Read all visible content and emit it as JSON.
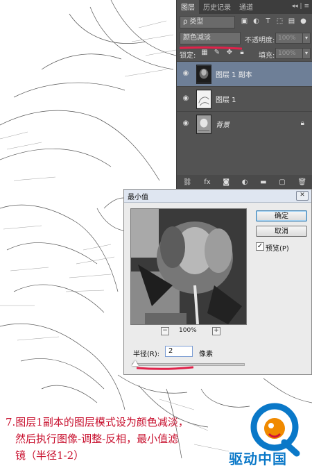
{
  "layers_panel": {
    "tabs": [
      "图层",
      "历史记录",
      "通道"
    ],
    "panel_menu": "◂◂ | ≡",
    "kind_filter": "ρ 类型",
    "blend_mode": "颜色减淡",
    "opacity_label": "不透明度:",
    "opacity_value": "100%",
    "lock_label": "锁定:",
    "fill_label": "填充:",
    "fill_value": "100%",
    "layers": [
      {
        "name": "图层 1 副本",
        "selected": true
      },
      {
        "name": "图层 1",
        "selected": false
      },
      {
        "name": "背景",
        "selected": false,
        "locked": true
      }
    ],
    "bottom_icons": [
      "link-icon",
      "fx-icon",
      "mask-icon",
      "adjustment-icon",
      "group-icon",
      "new-layer-icon",
      "trash-icon"
    ]
  },
  "dialog": {
    "title": "最小值",
    "close_label": "✕",
    "ok_label": "确定",
    "cancel_label": "取消",
    "preview_label": "预览(P)",
    "preview_checked": true,
    "zoom_minus": "−",
    "zoom_plus": "+",
    "zoom_value": "100%",
    "radius_label": "半径(R):",
    "radius_value": "2",
    "radius_unit": "像素"
  },
  "annotation": {
    "line1": "7.图层1副本的图层模式设为颜色减淡，",
    "line2": "然后执行图像-调整-反相，最小值滤",
    "line3": "镜（半径1-2）"
  },
  "logo": {
    "text": "驱动中国",
    "colors": {
      "blue": "#0a78c8",
      "orange": "#f08a00",
      "red": "#d0103a"
    }
  },
  "colors": {
    "highlight_red": "#e0224a",
    "panel_bg": "#535353",
    "selected_layer": "#6e7f97"
  }
}
